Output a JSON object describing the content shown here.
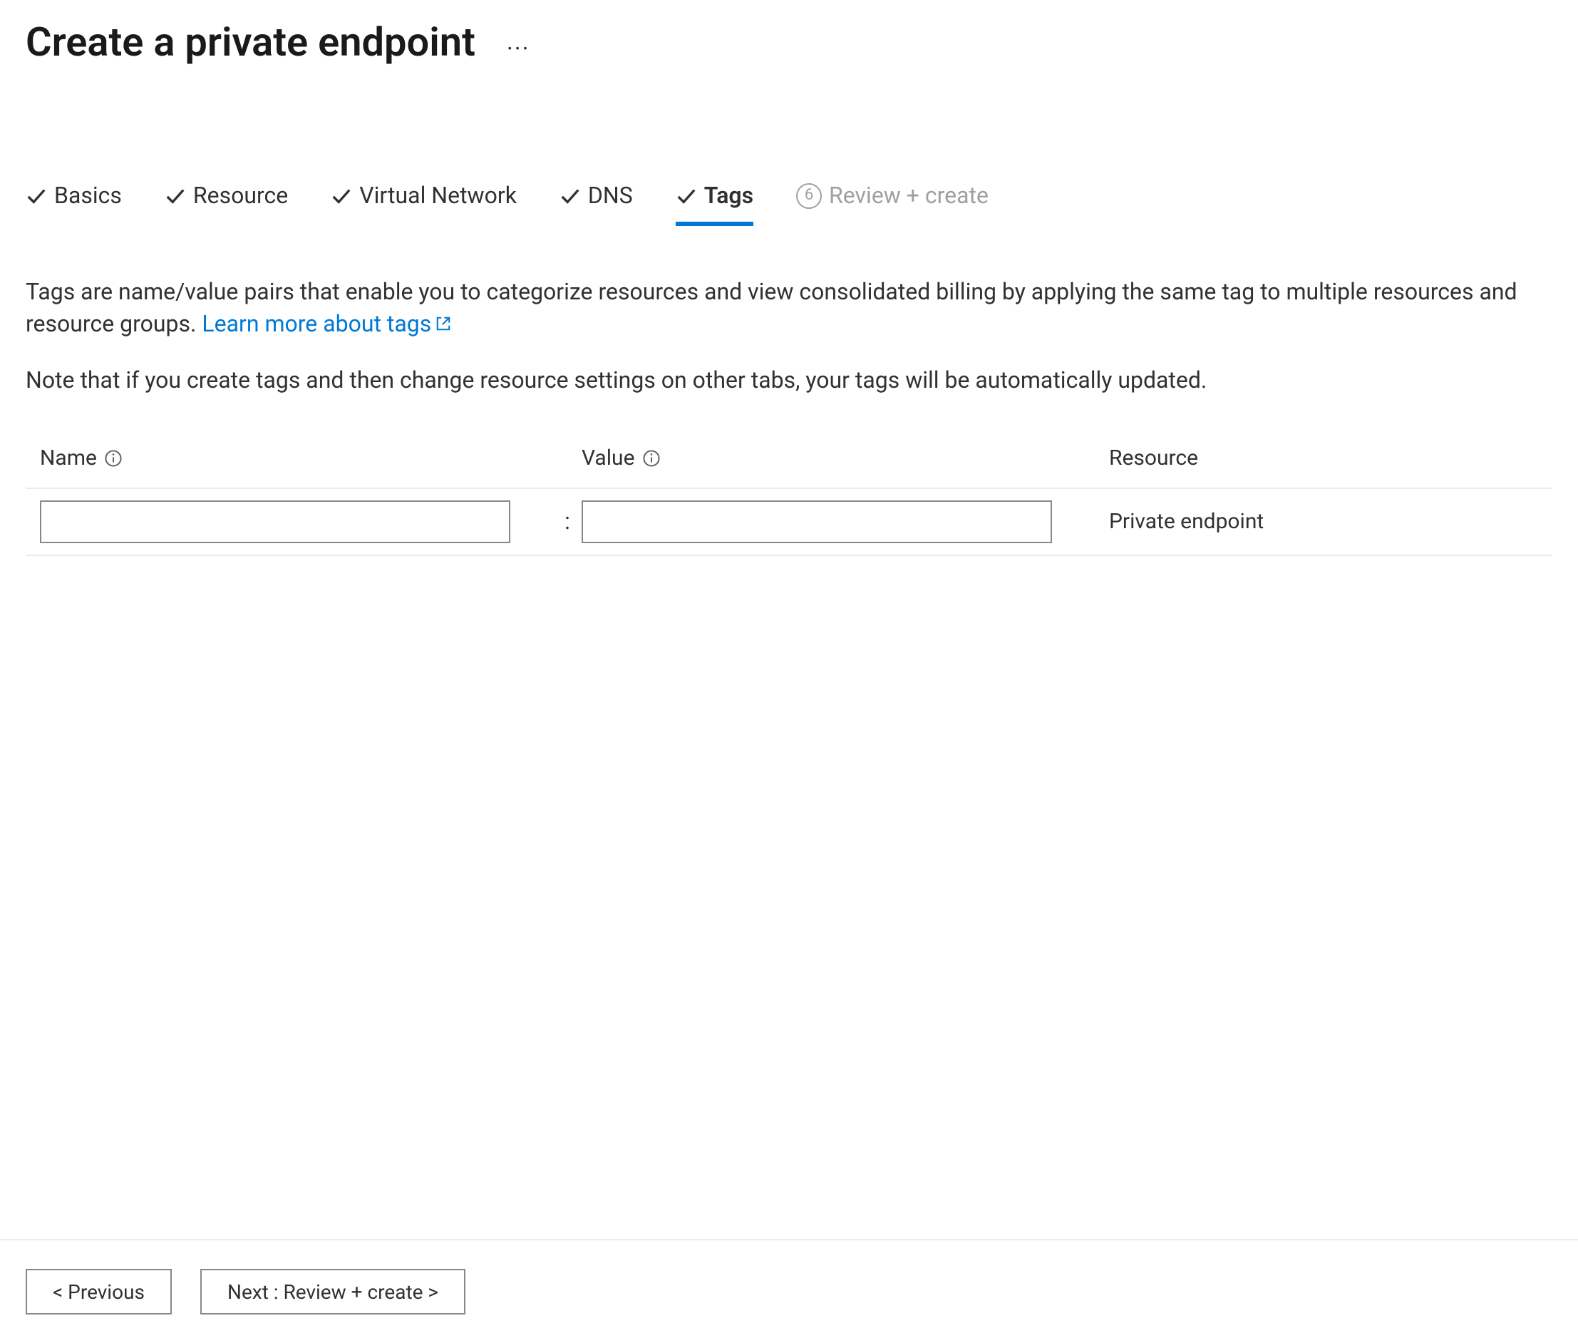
{
  "header": {
    "title": "Create a private endpoint"
  },
  "tabs": [
    {
      "label": "Basics",
      "state": "done"
    },
    {
      "label": "Resource",
      "state": "done"
    },
    {
      "label": "Virtual Network",
      "state": "done"
    },
    {
      "label": "DNS",
      "state": "done"
    },
    {
      "label": "Tags",
      "state": "active"
    },
    {
      "label": "Review + create",
      "state": "upcoming",
      "step": "6"
    }
  ],
  "intro": {
    "text": "Tags are name/value pairs that enable you to categorize resources and view consolidated billing by applying the same tag to multiple resources and resource groups. ",
    "link_text": "Learn more about tags"
  },
  "note": "Note that if you create tags and then change resource settings on other tabs, your tags will be automatically updated.",
  "table": {
    "headers": {
      "name": "Name",
      "value": "Value",
      "resource": "Resource"
    },
    "rows": [
      {
        "name": "",
        "value": "",
        "resource": "Private endpoint"
      }
    ]
  },
  "footer": {
    "previous": "< Previous",
    "next": "Next : Review + create >"
  }
}
